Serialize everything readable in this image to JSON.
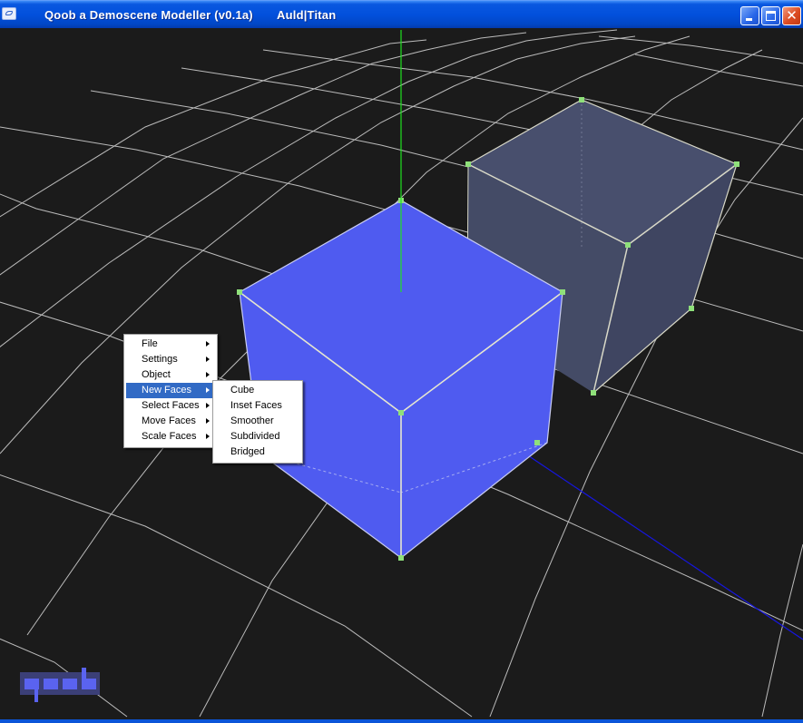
{
  "window": {
    "title": "Qoob a Demoscene Modeller (v0.1a)       Auld|Titan",
    "buttons": {
      "minimize": "",
      "maximize": "",
      "close": "✕"
    }
  },
  "viewport": {
    "background": "#1b1b1b",
    "grid_color": "#d8d8d8",
    "y_axis_color": "#1fe21f",
    "z_axis_color": "#1616e0",
    "selected_cube_color": "#4f5bf0",
    "unselected_cube_color": "#444b66",
    "vertex_color": "#8fe07a"
  },
  "context_menu": {
    "items": [
      {
        "label": "File",
        "has_submenu": true
      },
      {
        "label": "Settings",
        "has_submenu": true
      },
      {
        "label": "Object",
        "has_submenu": true
      },
      {
        "label": "New Faces",
        "has_submenu": true,
        "highlighted": true
      },
      {
        "label": "Select Faces",
        "has_submenu": true
      },
      {
        "label": "Move Faces",
        "has_submenu": true
      },
      {
        "label": "Scale Faces",
        "has_submenu": true
      }
    ],
    "highlight_color": "#316ac5"
  },
  "submenu_new_faces": {
    "items": [
      {
        "label": "Cube"
      },
      {
        "label": "Inset Faces"
      },
      {
        "label": "Smoother"
      },
      {
        "label": "Subdivided"
      },
      {
        "label": "Bridged"
      }
    ]
  },
  "logo": {
    "name": "qoob-logo",
    "color": "#5a63f0"
  }
}
